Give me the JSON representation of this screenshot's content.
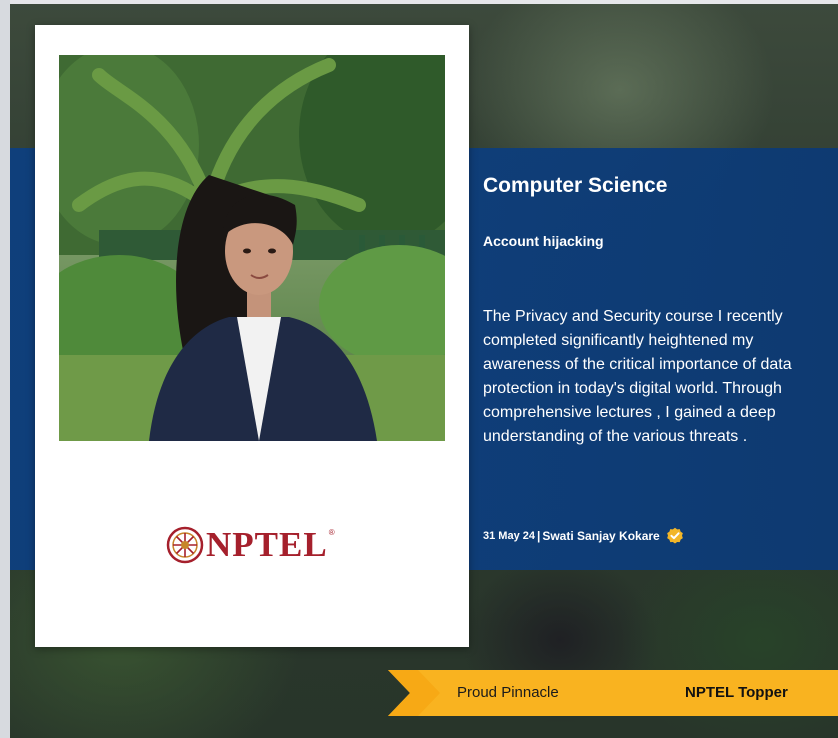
{
  "card": {
    "logo_text": "NPTEL",
    "logo_mark": "registered"
  },
  "content": {
    "title": "Computer Science",
    "subtitle": "Account hijacking",
    "description": "The Privacy and Security course I recently completed significantly heightened my awareness of the critical importance of data protection in today's digital world. Through comprehensive lectures , I gained a deep understanding of the various threats .",
    "date": "31 May 24",
    "separator": "|",
    "author": "Swati Sanjay Kokare",
    "verified_icon": "verified-badge-icon"
  },
  "ribbon": {
    "left_label": "Proud Pinnacle",
    "right_label": "NPTEL Topper"
  },
  "colors": {
    "band_blue": "#0e3f7d",
    "ribbon_yellow": "#f9b320",
    "logo_red": "#a5202c",
    "badge_gold": "#f2b628"
  }
}
